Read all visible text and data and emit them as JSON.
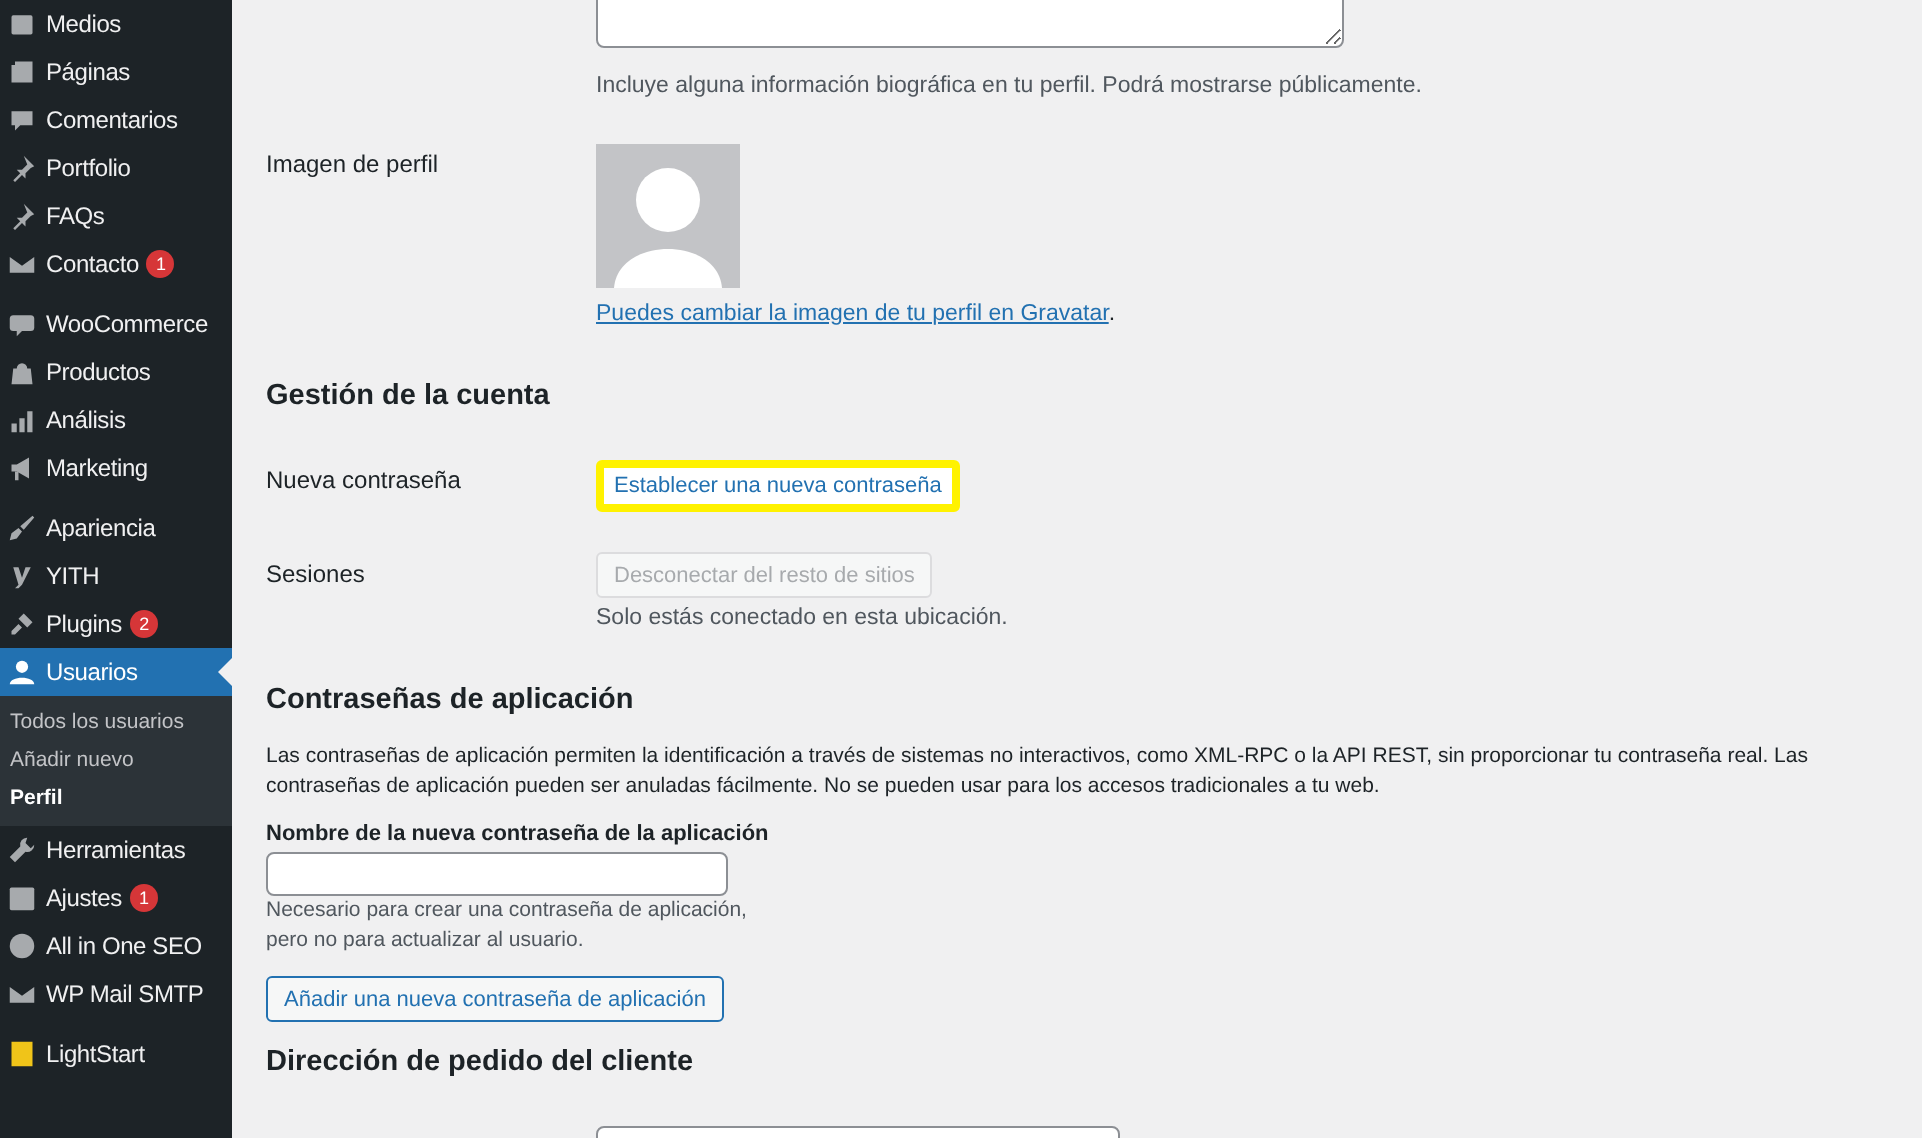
{
  "sidebar": {
    "groups": [
      [
        {
          "label": "Medios",
          "selected": false
        },
        {
          "label": "Páginas",
          "selected": false
        },
        {
          "label": "Comentarios",
          "selected": false
        },
        {
          "label": "Portfolio",
          "selected": false
        },
        {
          "label": "FAQs",
          "selected": false
        },
        {
          "label": "Contacto",
          "badge": "1",
          "selected": false
        }
      ],
      [
        {
          "label": "WooCommerce",
          "selected": false
        },
        {
          "label": "Productos",
          "selected": false
        },
        {
          "label": "Análisis",
          "selected": false
        },
        {
          "label": "Marketing",
          "selected": false
        }
      ],
      [
        {
          "label": "Apariencia",
          "selected": false
        },
        {
          "label": "YITH",
          "selected": false
        },
        {
          "label": "Plugins",
          "badge": "2",
          "selected": false
        },
        {
          "label": "Usuarios",
          "selected": true,
          "children": [
            {
              "label": "Todos los usuarios",
              "selected": false
            },
            {
              "label": "Añadir nuevo",
              "selected": false
            },
            {
              "label": "Perfil",
              "selected": true
            }
          ]
        },
        {
          "label": "Herramientas",
          "selected": false
        },
        {
          "label": "Ajustes",
          "badge": "1",
          "selected": false
        },
        {
          "label": "All in One SEO",
          "selected": false
        },
        {
          "label": "WP Mail SMTP",
          "selected": false
        }
      ],
      [
        {
          "label": "LightStart",
          "selected": false
        }
      ]
    ]
  },
  "bio": {
    "description": "Incluye alguna información biográfica en tu perfil. Podrá mostrarse públicamente."
  },
  "profile_picture": {
    "label": "Imagen de perfil",
    "link": "Puedes cambiar la imagen de tu perfil en Gravatar",
    "suffix": "."
  },
  "account": {
    "heading": "Gestión de la cuenta",
    "new_password": {
      "label": "Nueva contraseña",
      "button": "Establecer una nueva contraseña",
      "highlighted": true
    },
    "sessions": {
      "label": "Sesiones",
      "button": "Desconectar del resto de sitios",
      "disabled": true,
      "note": "Solo estás conectado en esta ubicación."
    }
  },
  "app_passwords": {
    "heading": "Contraseñas de aplicación",
    "description": "Las contraseñas de aplicación permiten la identificación a través de sistemas no interactivos, como XML-RPC o la API REST, sin proporcionar tu contraseña real. Las contraseñas de aplicación pueden ser anuladas fácilmente. No se pueden usar para los accesos tradicionales a tu web.",
    "field_label": "Nombre de la nueva contraseña de la aplicación",
    "help": [
      "Necesario para crear una contraseña de aplicación,",
      "pero no para actualizar al usuario."
    ],
    "button": "Añadir una nueva contraseña de aplicación"
  },
  "shipping": {
    "heading": "Dirección de pedido del cliente"
  }
}
